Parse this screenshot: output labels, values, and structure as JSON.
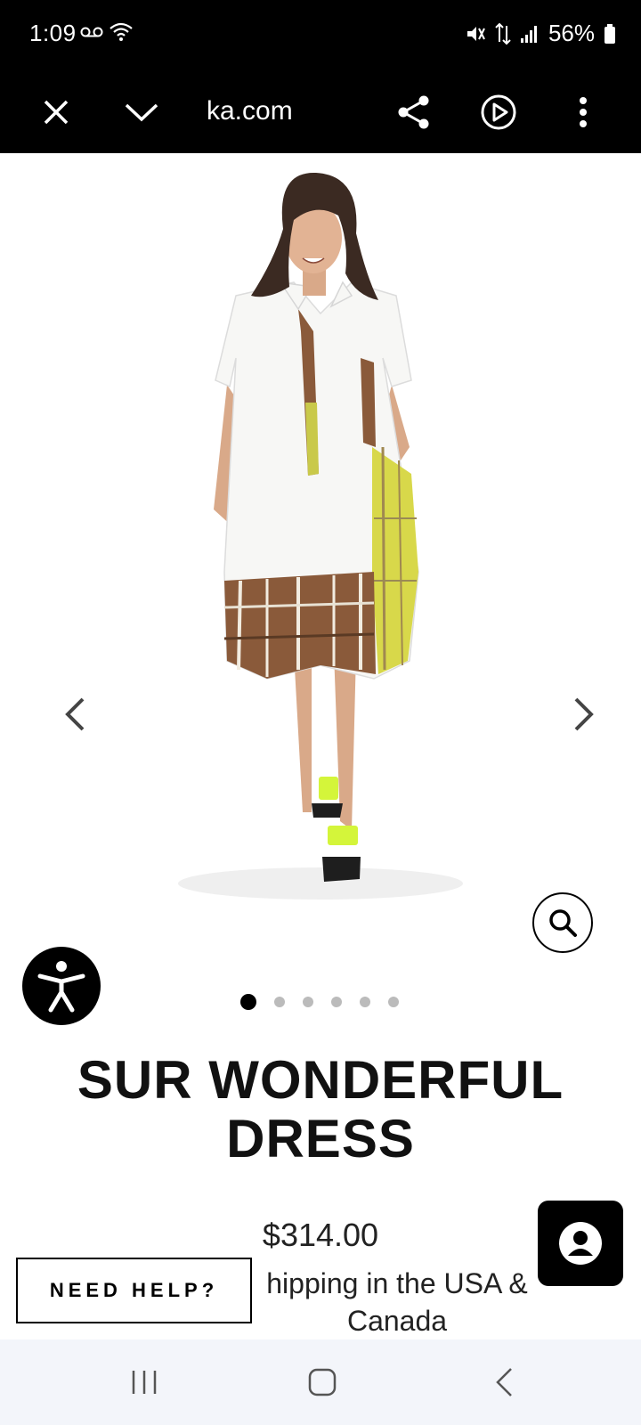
{
  "status_bar": {
    "time": "1:09",
    "battery": "56%",
    "icons": [
      "voicemail-icon",
      "wifi-icon",
      "mute-icon",
      "data-icon",
      "signal-icon",
      "battery-icon"
    ]
  },
  "toolbar": {
    "url": "ka.com",
    "icons": [
      "close-icon",
      "chevron-down-icon",
      "share-icon",
      "play-icon",
      "more-icon"
    ]
  },
  "product": {
    "title_line1": "SUR WONDERFUL",
    "title_line2": "DRESS",
    "price": "$314.00",
    "shipping_line1": "hipping in the USA &",
    "shipping_line2": "Canada",
    "image_count": 6,
    "active_image": 1
  },
  "need_help": {
    "label": "NEED HELP?"
  },
  "colors": {
    "bar_bg": "#000000",
    "nav_bg": "#f3f5fa",
    "plaid_brown": "#8a5a3a",
    "plaid_yellow": "#d8d84a",
    "neon": "#d4f53a"
  }
}
